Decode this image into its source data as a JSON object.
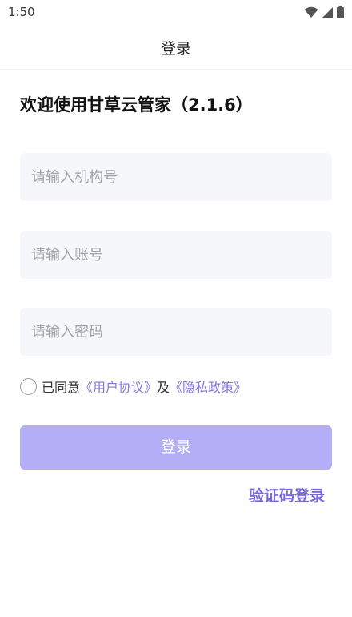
{
  "status_bar": {
    "time": "1:50",
    "icons": [
      "wifi-icon",
      "cellular-signal-icon",
      "battery-icon"
    ]
  },
  "nav": {
    "title": "登录"
  },
  "welcome": {
    "text": "欢迎使用甘草云管家（2.1.6）"
  },
  "form": {
    "org_placeholder": "请输入机构号",
    "org_value": "",
    "account_placeholder": "请输入账号",
    "account_value": "",
    "password_placeholder": "请输入密码",
    "password_value": ""
  },
  "agreement": {
    "checked": false,
    "prefix": "已同意",
    "user_agreement": "《用户协议》",
    "conjunction": "及",
    "privacy_policy": "《隐私政策》"
  },
  "login_button": {
    "label": "登录"
  },
  "sms_login": {
    "label": "验证码登录"
  },
  "colors": {
    "accent": "#7a68e0",
    "link": "#8574e0",
    "button_disabled": "#b3aef5",
    "field_bg": "#f6f7fa",
    "placeholder": "#a2a2a8"
  }
}
